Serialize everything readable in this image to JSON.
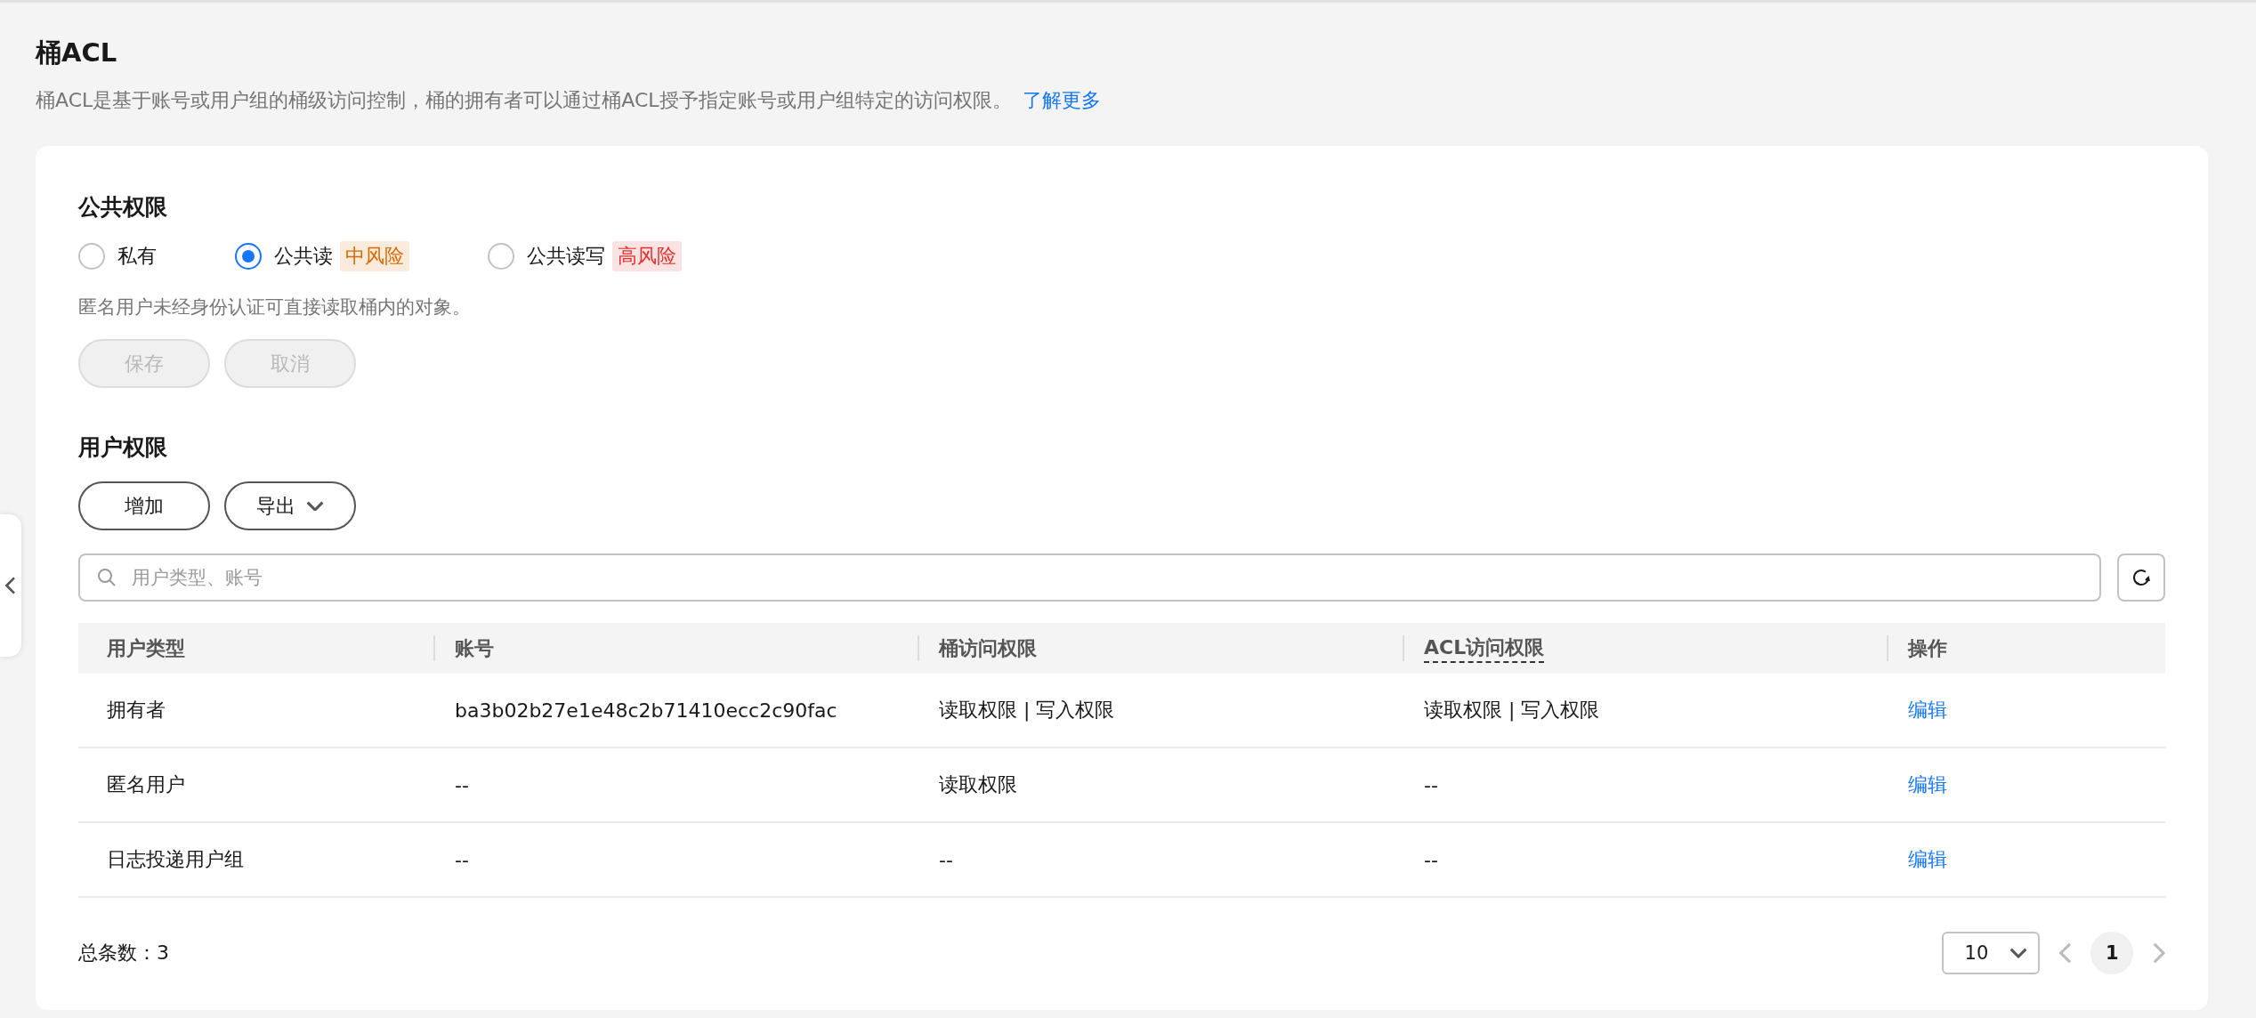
{
  "header": {
    "title": "桶ACL",
    "description": "桶ACL是基于账号或用户组的桶级访问控制，桶的拥有者可以通过桶ACL授予指定账号或用户组特定的访问权限。",
    "link": "了解更多"
  },
  "public_access": {
    "title": "公共权限",
    "options": [
      {
        "label": "私有",
        "selected": false
      },
      {
        "label": "公共读",
        "selected": true,
        "tag": "中风险",
        "color": "#d86b00"
      },
      {
        "label": "公共读写",
        "selected": false,
        "tag": "高风险",
        "color": "#e5302e"
      }
    ],
    "hint": "匿名用户未经身份认证可直接读取桶内的对象。",
    "buttons": [
      {
        "label": "保存",
        "disabled": true
      },
      {
        "label": "取消",
        "disabled": true
      }
    ]
  },
  "user_access": {
    "title": "用户权限",
    "buttons": [
      {
        "label": "增加",
        "kind": "plain"
      },
      {
        "label": "导出",
        "kind": "dropdown"
      }
    ],
    "search": {
      "placeholder": "用户类型、账号"
    },
    "table": {
      "columns": [
        {
          "label": "用户类型",
          "underlined": false
        },
        {
          "label": "账号",
          "underlined": false
        },
        {
          "label": "桶访问权限",
          "underlined": false
        },
        {
          "label": "ACL访问权限",
          "underlined": true
        },
        {
          "label": "操作",
          "underlined": false
        }
      ],
      "rows": [
        {
          "cells": [
            "拥有者",
            "ba3b02b27e1e48c2b71410ecc2c90fac",
            "读取权限 | 写入权限",
            "读取权限 | 写入权限"
          ],
          "action": "编辑"
        },
        {
          "cells": [
            "匿名用户",
            "--",
            "读取权限",
            "--"
          ],
          "action": "编辑"
        },
        {
          "cells": [
            "日志投递用户组",
            "--",
            "--",
            "--"
          ],
          "action": "编辑"
        }
      ]
    },
    "total": "总条数：3",
    "page_size": "10",
    "pages": [
      {
        "label": "1",
        "selected": true
      }
    ]
  }
}
